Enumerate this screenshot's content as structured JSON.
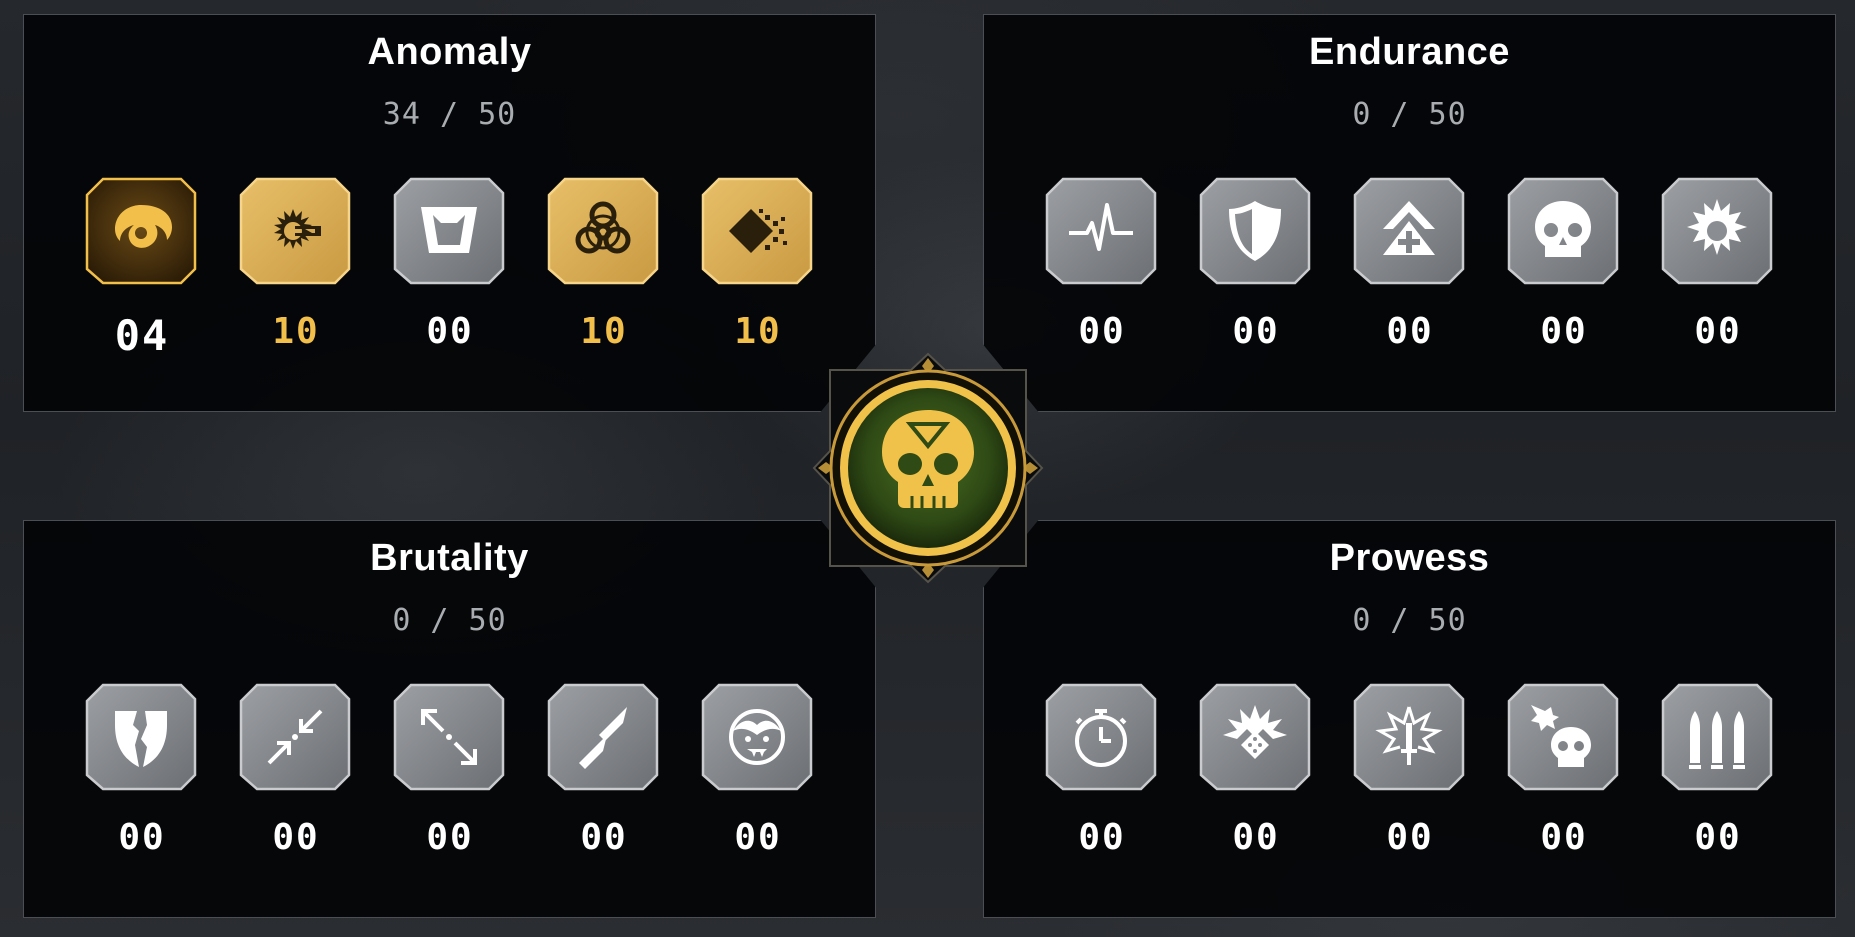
{
  "colors": {
    "gold": "#f2bf4a",
    "gold_tile": "#dcae55",
    "grey_tile": "#8a8d91",
    "panel_bg": "#030406",
    "emblem_green": "#3f5f1c"
  },
  "center_emblem": {
    "icon": "skull-triangle-icon"
  },
  "categories": [
    {
      "title": "Anomaly",
      "score": "34 / 50",
      "slots": [
        {
          "icon": "swirl-icon",
          "count": "04",
          "state": "active"
        },
        {
          "icon": "burning-magnet-icon",
          "count": "10",
          "state": "complete"
        },
        {
          "icon": "trapezoid-portal-icon",
          "count": "00",
          "state": "locked"
        },
        {
          "icon": "biohazard-icon",
          "count": "10",
          "state": "complete"
        },
        {
          "icon": "disintegrate-icon",
          "count": "10",
          "state": "complete"
        }
      ]
    },
    {
      "title": "Endurance",
      "score": "0 / 50",
      "slots": [
        {
          "icon": "heartbeat-icon",
          "count": "00",
          "state": "locked"
        },
        {
          "icon": "shield-icon",
          "count": "00",
          "state": "locked"
        },
        {
          "icon": "medic-chevron-icon",
          "count": "00",
          "state": "locked"
        },
        {
          "icon": "skull-icon",
          "count": "00",
          "state": "locked"
        },
        {
          "icon": "sun-burst-icon",
          "count": "00",
          "state": "locked"
        }
      ]
    },
    {
      "title": "Brutality",
      "score": "0 / 50",
      "slots": [
        {
          "icon": "shattered-shield-icon",
          "count": "00",
          "state": "locked"
        },
        {
          "icon": "converging-arrows-icon",
          "count": "00",
          "state": "locked"
        },
        {
          "icon": "expanding-arrows-icon",
          "count": "00",
          "state": "locked"
        },
        {
          "icon": "bullets-icon",
          "count": "00",
          "state": "locked"
        },
        {
          "icon": "vampire-face-icon",
          "count": "00",
          "state": "locked"
        }
      ]
    },
    {
      "title": "Prowess",
      "score": "0 / 50",
      "slots": [
        {
          "icon": "stopwatch-icon",
          "count": "00",
          "state": "locked"
        },
        {
          "icon": "grenade-burst-icon",
          "count": "00",
          "state": "locked"
        },
        {
          "icon": "explosion-dagger-icon",
          "count": "00",
          "state": "locked"
        },
        {
          "icon": "fire-skull-icon",
          "count": "00",
          "state": "locked"
        },
        {
          "icon": "ammo-icon",
          "count": "00",
          "state": "locked"
        }
      ]
    }
  ]
}
